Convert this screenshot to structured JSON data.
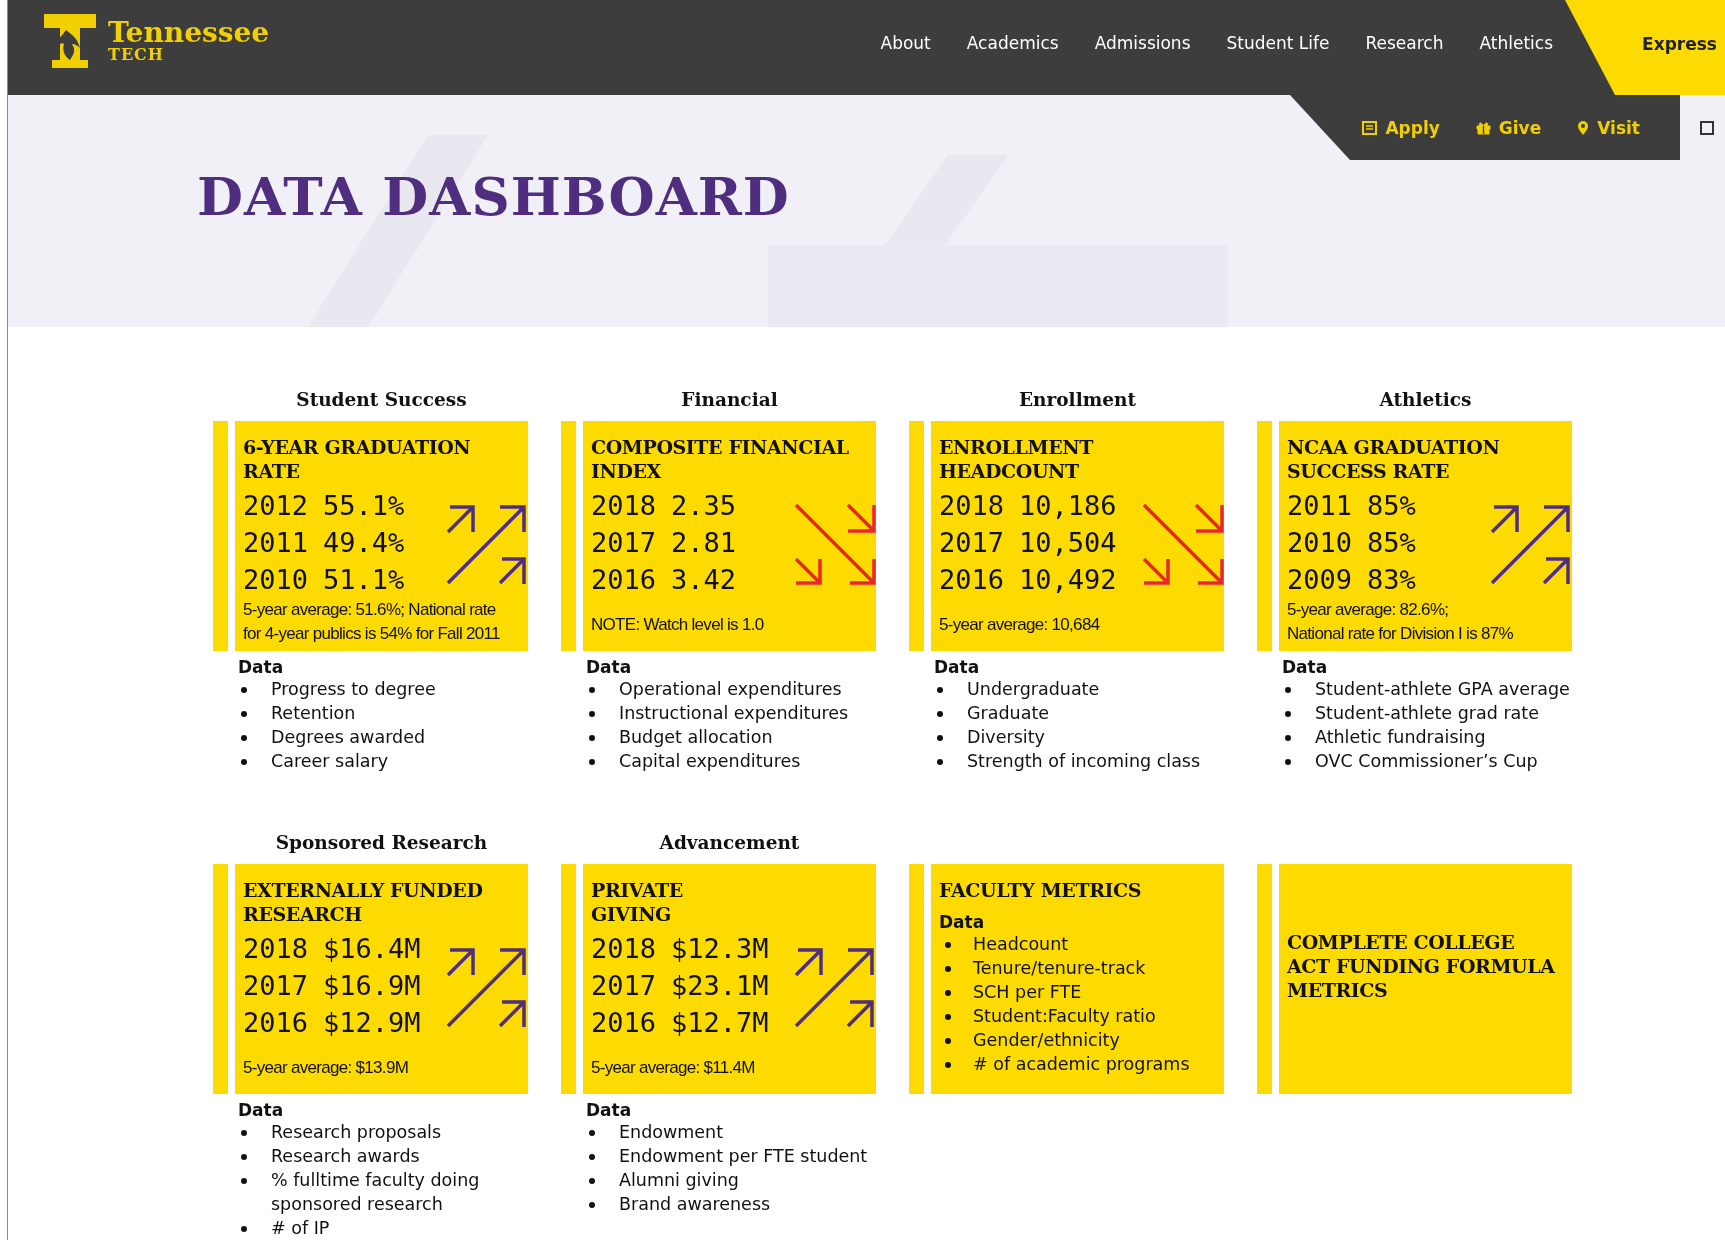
{
  "header": {
    "logo": {
      "name": "Tennessee",
      "sub": "TECH"
    },
    "nav": [
      "About",
      "Academics",
      "Admissions",
      "Student Life",
      "Research",
      "Athletics"
    ],
    "express": "Express",
    "utility": [
      "Apply",
      "Give",
      "Visit"
    ]
  },
  "hero": {
    "title": "DATA DASHBOARD"
  },
  "sections": [
    {
      "heading": "Student Success",
      "card": {
        "kind": "metric",
        "title_lines": [
          "6-YEAR GRADUATION",
          "RATE"
        ],
        "rows": [
          {
            "year": "2012",
            "value": "55.1%"
          },
          {
            "year": "2011",
            "value": "49.4%"
          },
          {
            "year": "2010",
            "value": "51.1%"
          }
        ],
        "rising": true,
        "note_lines": [
          "5-year average: 51.6%; National rate",
          "for 4-year publics is 54% for Fall 2011"
        ]
      },
      "data_label": "Data",
      "data_items": [
        "Progress to degree",
        "Retention",
        "Degrees awarded",
        "Career salary"
      ]
    },
    {
      "heading": "Financial",
      "card": {
        "kind": "metric",
        "title_lines": [
          "COMPOSITE FINANCIAL",
          "INDEX"
        ],
        "rows": [
          {
            "year": "2018",
            "value": "2.35"
          },
          {
            "year": "2017",
            "value": "2.81"
          },
          {
            "year": "2016",
            "value": "3.42"
          }
        ],
        "rising": false,
        "note_lines": [
          "NOTE: Watch level is 1.0"
        ]
      },
      "data_label": "Data",
      "data_items": [
        "Operational expenditures",
        "Instructional expenditures",
        "Budget allocation",
        "Capital expenditures"
      ]
    },
    {
      "heading": "Enrollment",
      "card": {
        "kind": "metric",
        "title_lines": [
          "ENROLLMENT",
          "HEADCOUNT"
        ],
        "rows": [
          {
            "year": "2018",
            "value": "10,186"
          },
          {
            "year": "2017",
            "value": "10,504"
          },
          {
            "year": "2016",
            "value": "10,492"
          }
        ],
        "rising": false,
        "note_lines": [
          "5-year average: 10,684"
        ]
      },
      "data_label": "Data",
      "data_items": [
        "Undergraduate",
        "Graduate",
        "Diversity",
        "Strength of incoming class"
      ]
    },
    {
      "heading": "Athletics",
      "card": {
        "kind": "metric",
        "title_lines": [
          "NCAA GRADUATION",
          "SUCCESS RATE"
        ],
        "rows": [
          {
            "year": "2011",
            "value": "85%"
          },
          {
            "year": "2010",
            "value": "85%"
          },
          {
            "year": "2009",
            "value": "83%"
          }
        ],
        "rising": true,
        "note_lines": [
          "5-year average: 82.6%;",
          "National rate for Division I is 87%"
        ]
      },
      "data_label": "Data",
      "data_items": [
        "Student-athlete GPA average",
        "Student-athlete grad rate",
        "Athletic fundraising",
        "OVC Commissioner’s Cup"
      ]
    },
    {
      "heading": "Sponsored Research",
      "card": {
        "kind": "metric",
        "title_lines": [
          "EXTERNALLY FUNDED",
          "RESEARCH"
        ],
        "rows": [
          {
            "year": "2018",
            "value": "$16.4M"
          },
          {
            "year": "2017",
            "value": "$16.9M"
          },
          {
            "year": "2016",
            "value": "$12.9M"
          }
        ],
        "rising": true,
        "note_lines": [
          "5-year average: $13.9M"
        ]
      },
      "data_label": "Data",
      "data_items": [
        "Research proposals",
        "Research awards",
        "% fulltime faculty doing sponsored research",
        "# of IP"
      ]
    },
    {
      "heading": "Advancement",
      "card": {
        "kind": "metric",
        "title_lines": [
          "PRIVATE",
          "GIVING"
        ],
        "rows": [
          {
            "year": "2018",
            "value": "$12.3M"
          },
          {
            "year": "2017",
            "value": "$23.1M"
          },
          {
            "year": "2016",
            "value": "$12.7M"
          }
        ],
        "rising": true,
        "note_lines": [
          "5-year average: $11.4M"
        ]
      },
      "data_label": "Data",
      "data_items": [
        "Endowment",
        "Endowment per FTE student",
        "Alumni giving",
        "Brand awareness"
      ]
    },
    {
      "card": {
        "kind": "list",
        "title_lines": [
          "FACULTY METRICS"
        ],
        "data_label": "Data",
        "items": [
          "Headcount",
          "Tenure/tenure-track",
          "SCH per FTE",
          "Student:Faculty ratio",
          "Gender/ethnicity",
          "# of academic programs"
        ]
      }
    },
    {
      "card": {
        "kind": "title",
        "title_lines": [
          "COMPLETE COLLEGE",
          "ACT FUNDING FORMULA",
          "METRICS"
        ]
      }
    }
  ]
}
